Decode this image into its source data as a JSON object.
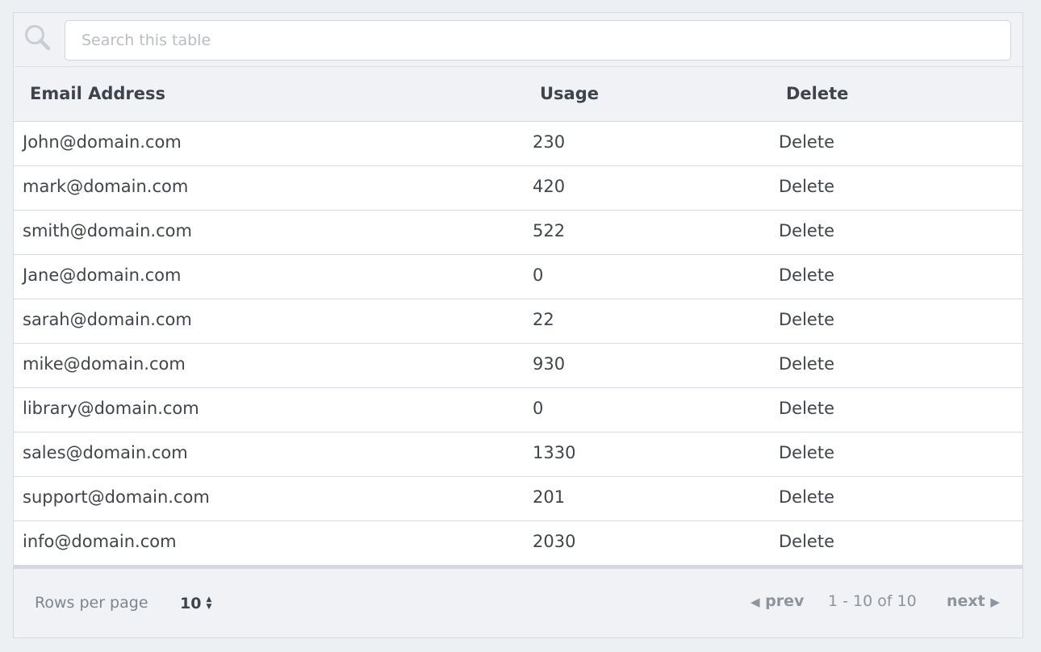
{
  "search": {
    "placeholder": "Search this table",
    "value": ""
  },
  "table": {
    "columns": [
      "Email Address",
      "Usage",
      "Delete"
    ],
    "rows": [
      {
        "email": "John@domain.com",
        "usage": "230",
        "action": "Delete"
      },
      {
        "email": "mark@domain.com",
        "usage": "420",
        "action": "Delete"
      },
      {
        "email": "smith@domain.com",
        "usage": "522",
        "action": "Delete"
      },
      {
        "email": "Jane@domain.com",
        "usage": "0",
        "action": "Delete"
      },
      {
        "email": "sarah@domain.com",
        "usage": "22",
        "action": "Delete"
      },
      {
        "email": "mike@domain.com",
        "usage": "930",
        "action": "Delete"
      },
      {
        "email": "library@domain.com",
        "usage": "0",
        "action": "Delete"
      },
      {
        "email": "sales@domain.com",
        "usage": "1330",
        "action": "Delete"
      },
      {
        "email": "support@domain.com",
        "usage": "201",
        "action": "Delete"
      },
      {
        "email": "info@domain.com",
        "usage": "2030",
        "action": "Delete"
      }
    ]
  },
  "footer": {
    "rows_per_page_label": "Rows per page",
    "rows_per_page_value": "10",
    "prev_label": "prev",
    "page_info": "1 - 10 of 10",
    "next_label": "next"
  },
  "icons": {
    "search": "search-icon",
    "sort_arrows": "sort-arrows-icon",
    "prev": "caret-left-icon",
    "next": "caret-right-icon"
  },
  "colors": {
    "background": "#edf0f3",
    "header_text": "#3f444b",
    "muted_text": "#8e949c",
    "placeholder": "#b9bec5"
  }
}
